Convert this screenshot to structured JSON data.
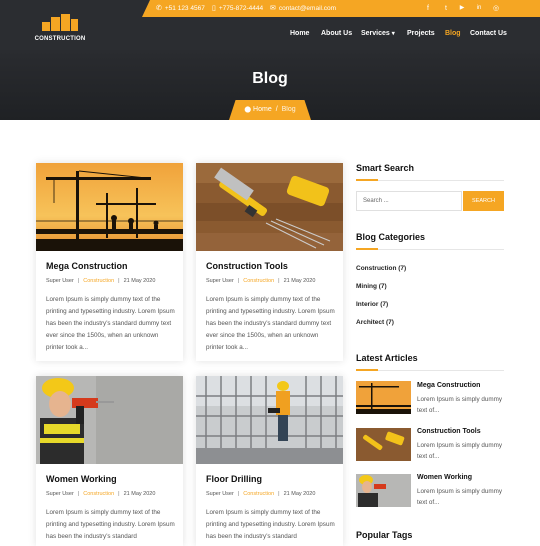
{
  "brand": {
    "logo_text": "CONSTRUCTION",
    "accent": "#f5a623",
    "dark": "#2b2d31"
  },
  "topbar": {
    "phone1": "+51 123 4567",
    "phone2": "+775-872-4444",
    "email": "contact@email.com",
    "social": [
      "facebook-icon",
      "twitter-icon",
      "youtube-icon",
      "linkedin-icon",
      "instagram-icon"
    ],
    "social_glyphs": [
      "f",
      "t",
      "▶",
      "in",
      "◎"
    ]
  },
  "nav": {
    "home": "Home",
    "about": "About Us",
    "services": "Services",
    "projects": "Projects",
    "blog": "Blog",
    "contact": "Contact Us"
  },
  "hero": {
    "title": "Blog",
    "crumb_home": "Home",
    "crumb_sep": "/",
    "crumb_current": "Blog"
  },
  "posts": [
    {
      "title": "Mega Construction",
      "author": "Super User",
      "category": "Construction",
      "date": "21 May 2020",
      "excerpt": "Lorem Ipsum is simply dummy text of the printing and typesetting industry. Lorem Ipsum has been the industry's standard dummy text ever since the 1500s, when an unknown printer took a..."
    },
    {
      "title": "Construction Tools",
      "author": "Super User",
      "category": "Construction",
      "date": "21 May 2020",
      "excerpt": "Lorem Ipsum is simply dummy text of the printing and typesetting industry. Lorem Ipsum has been the industry's standard dummy text ever since the 1500s, when an unknown printer took a..."
    },
    {
      "title": "Women Working",
      "author": "Super User",
      "category": "Construction",
      "date": "21 May 2020",
      "excerpt": "Lorem Ipsum is simply dummy text of the printing and typesetting industry. Lorem Ipsum has been the industry's standard"
    },
    {
      "title": "Floor Drilling",
      "author": "Super User",
      "category": "Construction",
      "date": "21 May 2020",
      "excerpt": "Lorem Ipsum is simply dummy text of the printing and typesetting industry. Lorem Ipsum has been the industry's standard"
    }
  ],
  "sidebar": {
    "search_title": "Smart Search",
    "search_placeholder": "Search ...",
    "search_button": "SEARCH",
    "categories_title": "Blog Categories",
    "categories": [
      "Construction (7)",
      "Mining (7)",
      "Interior (7)",
      "Architect (7)"
    ],
    "latest_title": "Latest Articles",
    "latest": [
      {
        "title": "Mega Construction",
        "text": "Lorem Ipsum is simply dummy text of..."
      },
      {
        "title": "Construction Tools",
        "text": "Lorem Ipsum is simply dummy text of..."
      },
      {
        "title": "Women Working",
        "text": "Lorem Ipsum is simply dummy text of..."
      }
    ],
    "tags_title": "Popular Tags"
  }
}
